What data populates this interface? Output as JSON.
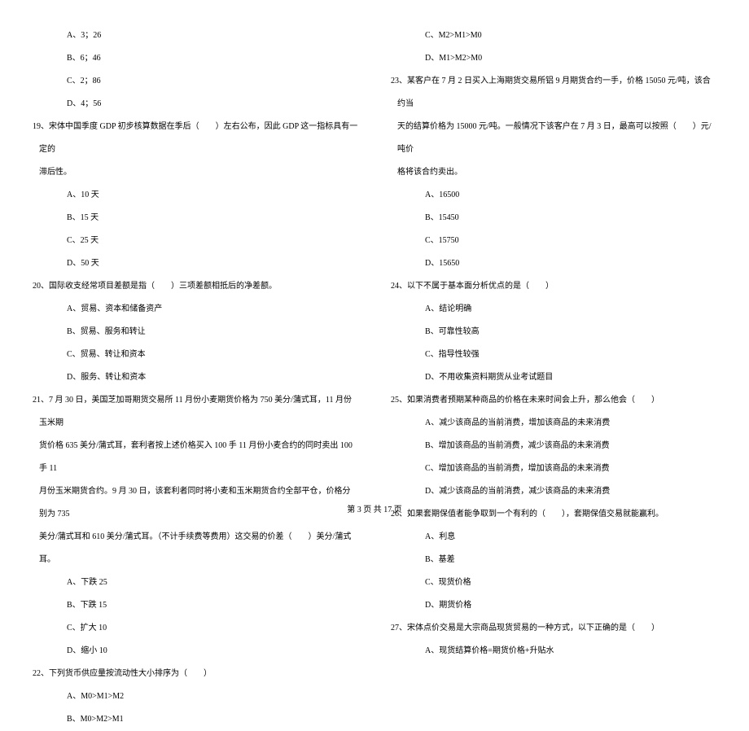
{
  "left_column": {
    "q18_options": [
      "A、3；26",
      "B、6；46",
      "C、2；86",
      "D、4；56"
    ],
    "q19_text": "19、宋体中国季度 GDP 初步核算数据在季后（　　）左右公布，因此 GDP 这一指标具有一定的",
    "q19_cont": "滞后性。",
    "q19_options": [
      "A、10 天",
      "B、15 天",
      "C、25 天",
      "D、50 天"
    ],
    "q20_text": "20、国际收支经常项目差额是指（　　）三项差额相抵后的净差额。",
    "q20_options": [
      "A、贸易、资本和储备资产",
      "B、贸易、服务和转让",
      "C、贸易、转让和资本",
      "D、服务、转让和资本"
    ],
    "q21_text": "21、7 月 30 日，美国芝加哥期货交易所 11 月份小麦期货价格为 750 美分/蒲式耳，11 月份玉米期",
    "q21_cont1": "货价格 635 美分/蒲式耳，套利者按上述价格买入 100 手 11 月份小麦合约的同时卖出 100 手 11",
    "q21_cont2": "月份玉米期货合约。9 月 30 日，该套利者同时将小麦和玉米期货合约全部平仓，价格分别为 735",
    "q21_cont3": "美分/蒲式耳和 610 美分/蒲式耳。（不计手续费等费用）这交易的价差（　　）美分/蒲式耳。",
    "q21_options": [
      "A、下跌 25",
      "B、下跌 15",
      "C、扩大 10",
      "D、缩小 10"
    ],
    "q22_text": "22、下列货币供应量按流动性大小排序为（　　）",
    "q22_options": [
      "A、M0>M1>M2",
      "B、M0>M2>M1"
    ]
  },
  "right_column": {
    "q22_options_cont": [
      "C、M2>M1>M0",
      "D、M1>M2>M0"
    ],
    "q23_text": "23、某客户在 7 月 2 日买入上海期货交易所铝 9 月期货合约一手，价格 15050 元/吨，该合约当",
    "q23_cont1": "天的结算价格为 15000 元/吨。一般情况下该客户在 7 月 3 日，最高可以按照（　　）元/吨价",
    "q23_cont2": "格将该合约卖出。",
    "q23_options": [
      "A、16500",
      "B、15450",
      "C、15750",
      "D、15650"
    ],
    "q24_text": "24、以下不属于基本面分析优点的是（　　）",
    "q24_options": [
      "A、结论明确",
      "B、可靠性较高",
      "C、指导性较强",
      "D、不用收集资料期货从业考试题目"
    ],
    "q25_text": "25、如果消费者预期某种商品的价格在未来时间会上升，那么他会（　　）",
    "q25_options": [
      "A、减少该商品的当前消费，增加该商品的未来消费",
      "B、增加该商品的当前消费，减少该商品的未来消费",
      "C、增加该商品的当前消费，增加该商品的未来消费",
      "D、减少该商品的当前消费，减少该商品的未来消费"
    ],
    "q26_text": "26、如果套期保值者能争取到一个有利的（　　），套期保值交易就能赢利。",
    "q26_options": [
      "A、利息",
      "B、基差",
      "C、现货价格",
      "D、期货价格"
    ],
    "q27_text": "27、宋体点价交易是大宗商品现货贸易的一种方式，以下正确的是（　　）",
    "q27_options": [
      "A、现货结算价格=期货价格+升贴水"
    ]
  },
  "footer": "第 3 页 共 17 页"
}
